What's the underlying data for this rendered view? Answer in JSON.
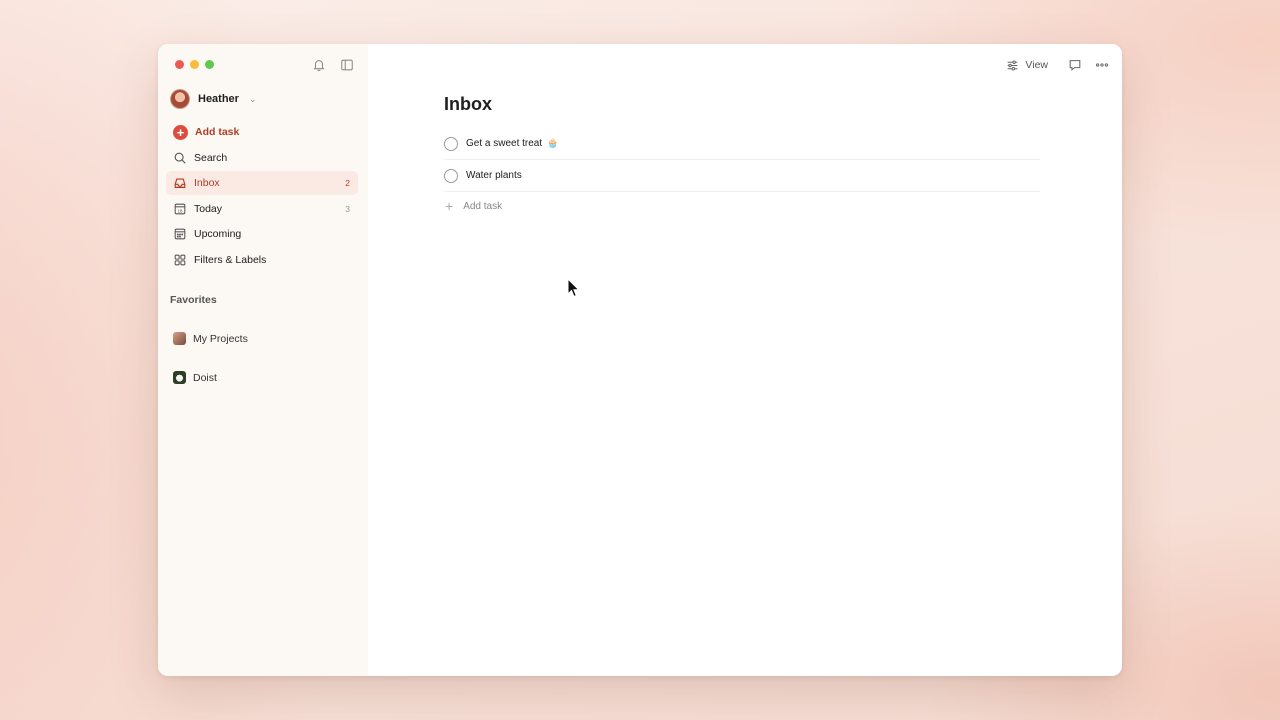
{
  "colors": {
    "accent": "#dc4c3e",
    "active_bg": "#fbe9e3",
    "sidebar_bg": "#fcf9f5"
  },
  "sidebar": {
    "user_name": "Heather",
    "add_task_label": "Add task",
    "nav": [
      {
        "label": "Search",
        "icon": "search-icon",
        "count": ""
      },
      {
        "label": "Inbox",
        "icon": "inbox-icon",
        "count": "2"
      },
      {
        "label": "Today",
        "icon": "calendar-today-icon",
        "count": "3"
      },
      {
        "label": "Upcoming",
        "icon": "calendar-grid-icon",
        "count": ""
      },
      {
        "label": "Filters & Labels",
        "icon": "filters-grid-icon",
        "count": ""
      }
    ],
    "favorites_title": "Favorites",
    "projects": [
      {
        "label": "My Projects"
      },
      {
        "label": "Doist"
      }
    ]
  },
  "toolbar": {
    "view_label": "View"
  },
  "main": {
    "title": "Inbox",
    "tasks": [
      {
        "label": "Get a sweet treat",
        "emoji": "🧁"
      },
      {
        "label": "Water plants",
        "emoji": ""
      }
    ],
    "add_task_label": "Add task"
  }
}
